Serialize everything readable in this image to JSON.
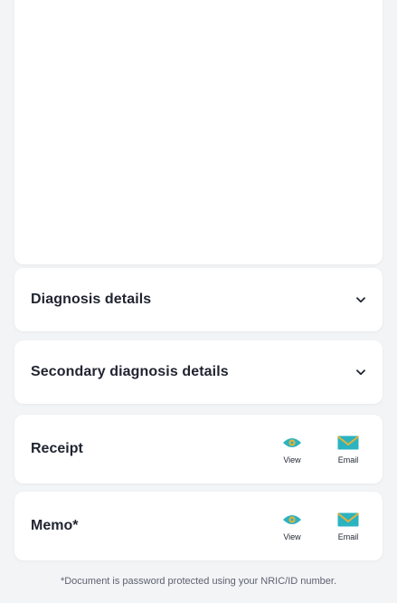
{
  "sections": {
    "diagnosis": {
      "label": "Diagnosis details"
    },
    "secondary_diagnosis": {
      "label": "Secondary diagnosis details"
    }
  },
  "documents": {
    "receipt": {
      "label": "Receipt",
      "view_label": "View",
      "email_label": "Email"
    },
    "memo": {
      "label": "Memo*",
      "view_label": "View",
      "email_label": "Email"
    }
  },
  "footnote": "*Document is password protected using your NRIC/ID number.",
  "icons": {
    "chevron": "chevron-down-icon",
    "view": "eye-icon",
    "email": "envelope-icon"
  },
  "colors": {
    "accent_teal": "#2bb3c0",
    "accent_gold": "#e3b23c",
    "text_dark": "#1f2430",
    "background": "#f3f4f6"
  }
}
